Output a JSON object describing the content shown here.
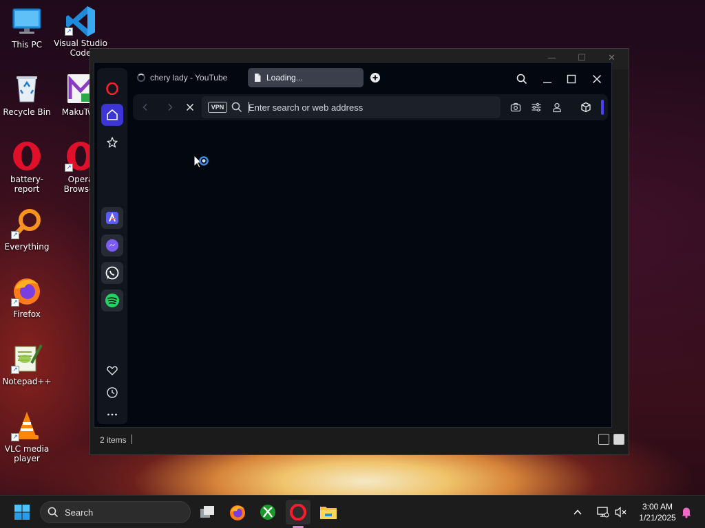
{
  "desktop": {
    "icons": [
      {
        "label": "This PC"
      },
      {
        "label": "Visual Studio Code"
      },
      {
        "label": "Recycle Bin"
      },
      {
        "label": "MakuTwe"
      },
      {
        "label": "battery-report"
      },
      {
        "label": "Opera Browser"
      },
      {
        "label": "Everything"
      },
      {
        "label": "Firefox"
      },
      {
        "label": "Notepad++"
      },
      {
        "label": "VLC media player"
      }
    ]
  },
  "explorer": {
    "status_items": "2 items"
  },
  "opera": {
    "tabs": [
      {
        "label": "chery lady - YouTube",
        "state": "loading"
      },
      {
        "label": "Loading...",
        "state": "active"
      }
    ],
    "address": {
      "vpn_label": "VPN",
      "placeholder": "Enter search or web address",
      "value": ""
    },
    "sidebar": {
      "items": [
        "opera-logo",
        "home",
        "favorites",
        "aria",
        "messenger",
        "whatsapp",
        "spotify",
        "heart",
        "history",
        "more"
      ]
    },
    "accent": "#3d36d6"
  },
  "taskbar": {
    "search_label": "Search",
    "time": "3:00 AM",
    "date": "1/21/2025"
  }
}
